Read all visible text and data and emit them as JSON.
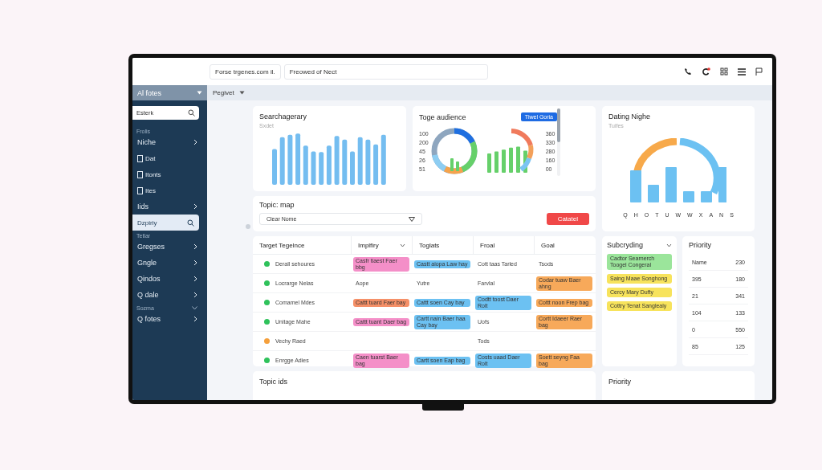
{
  "topbar": {
    "address": "Forse trgenes.com il.",
    "search": "Freowed of Nect",
    "notification_dot": true
  },
  "sidebar": {
    "title": "Al fotes",
    "search": {
      "placeholder": "Esterk"
    },
    "sections": [
      {
        "label": "Frolis",
        "expanded": false,
        "items": [
          {
            "label": "Niche",
            "kind": "chevron",
            "selected": false
          },
          {
            "label": "Dat",
            "kind": "icon",
            "selected": false
          },
          {
            "label": "Itonts",
            "kind": "icon",
            "selected": false
          },
          {
            "label": "Ites",
            "kind": "icon",
            "selected": false
          },
          {
            "label": "Iids",
            "kind": "chevron",
            "selected": false
          },
          {
            "label": "Dzpiriy",
            "kind": "search",
            "selected": true
          }
        ]
      },
      {
        "label": "Tetlar",
        "expanded": false,
        "items": [
          {
            "label": "Gregses",
            "kind": "chevron",
            "selected": false
          },
          {
            "label": "Gngle",
            "kind": "chevron",
            "selected": false
          },
          {
            "label": "Qindos",
            "kind": "chevron",
            "selected": false
          },
          {
            "label": "Q dale",
            "kind": "chevron",
            "selected": false
          }
        ]
      },
      {
        "label": "Sozma",
        "expanded": true,
        "items": [
          {
            "label": "Q fotes",
            "kind": "chevron",
            "selected": false
          }
        ]
      }
    ]
  },
  "toolbar": {
    "view": "Pegivet"
  },
  "search_card": {
    "title": "Searchagerary",
    "subtitle": "Sxdet"
  },
  "audience_card": {
    "title": "Toge audience",
    "button": "Tiwel Goria",
    "left_ticks": [
      "100",
      "200",
      "45",
      "26",
      "51"
    ],
    "right_ticks": [
      "360",
      "330",
      "280",
      "160",
      "00"
    ]
  },
  "dating_card": {
    "title": "Dating Nighe",
    "subtitle": "Tuifes",
    "labels": [
      "Q",
      "H",
      "O",
      "T",
      "U",
      "W",
      "W",
      "X",
      "A",
      "N",
      "S"
    ]
  },
  "topic_map": {
    "title": "Topic: map",
    "select": "Clear Nome",
    "button": "Catatel"
  },
  "table": {
    "columns": [
      {
        "label": "Target Tegelnce",
        "sortable": false
      },
      {
        "label": "Implfiry",
        "sortable": true
      },
      {
        "label": "Toglats",
        "sortable": false
      },
      {
        "label": "Froal",
        "sortable": false
      },
      {
        "label": "Goal",
        "sortable": false
      }
    ],
    "rows": [
      {
        "cells": [
          {
            "text": "Derall sehoures",
            "color": "#2fc25b"
          },
          {
            "text": "Casfr tiaest Faer bbg",
            "color": "#f48fc8"
          },
          {
            "text": "Castt aiopa Law hay",
            "color": "#6cc1f2"
          },
          {
            "text": "Cott taas Tarled"
          },
          {
            "text": "Tsods"
          }
        ]
      },
      {
        "cells": [
          {
            "text": "Locrarge Nelas",
            "color": "#2fc25b"
          },
          {
            "text": "Aope"
          },
          {
            "text": "Yutre"
          },
          {
            "text": "Farvlal"
          },
          {
            "text": "Codar tuaw Baer ahng",
            "color": "#f7a95a"
          }
        ]
      },
      {
        "cells": [
          {
            "text": "Comamel Mdes",
            "color": "#2fc25b"
          },
          {
            "text": "Cattt tuard Faer bay",
            "color": "#f59068"
          },
          {
            "text": "Cattt soen Cay bay",
            "color": "#6cc1f2"
          },
          {
            "text": "Codtt toost Daer Rolt",
            "color": "#6cc1f2"
          },
          {
            "text": "Cottt noon Frep bag",
            "color": "#f7a95a"
          }
        ]
      },
      {
        "cells": [
          {
            "text": "Unitage Mahe",
            "color": "#2fc25b"
          },
          {
            "text": "Cattt tuant Daer bag",
            "color": "#f48fc8"
          },
          {
            "text": "Cartt nain Baer haa Cay bay",
            "color": "#6cc1f2"
          },
          {
            "text": "Uofs"
          },
          {
            "text": "Cortt Idaeer Raer bag",
            "color": "#f7a95a"
          }
        ]
      },
      {
        "cells": [
          {
            "text": "Vechy Raed",
            "color": "#f5a03c"
          },
          {},
          {},
          {
            "text": "Tods"
          },
          {}
        ]
      },
      {
        "cells": [
          {
            "text": "Enrgge Adies",
            "color": "#2fc25b"
          },
          {
            "text": "Caen tuarst Baer bag",
            "color": "#f48fc8"
          },
          {
            "text": "Cartt soen Eap bag",
            "color": "#6cc1f2"
          },
          {
            "text": "Costs uaad Daer Rolt",
            "color": "#6cc1f2"
          },
          {
            "text": "Soett seyng Faa bag",
            "color": "#f7a95a"
          }
        ]
      }
    ]
  },
  "subscribing": {
    "title": "Subcryding",
    "notes": [
      {
        "text": "Cadtor Searnerch Toogel Congeral",
        "color": "#9be59b"
      },
      {
        "text": "Saing Maae Songhong",
        "color": "#f7e35c"
      },
      {
        "text": "Cercy Mary Dufty",
        "color": "#f7e35c"
      },
      {
        "text": "Cottry Tenat Sanglealy",
        "color": "#f7e35c"
      }
    ]
  },
  "priority": {
    "title": "Priority",
    "rows": [
      [
        "Name",
        "230"
      ],
      [
        "395",
        "180"
      ],
      [
        "21",
        "341"
      ],
      [
        "104",
        "133"
      ],
      [
        "0",
        "550"
      ],
      [
        "85",
        "125"
      ]
    ]
  },
  "bottom_cards": [
    {
      "title": "Topic ids"
    },
    {
      "title": "Priority"
    }
  ]
}
